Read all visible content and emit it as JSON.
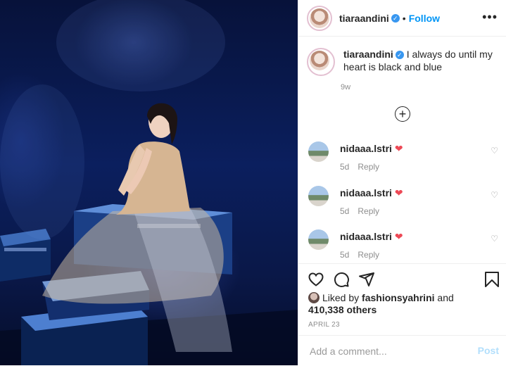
{
  "post": {
    "username": "tiaraandini",
    "separator": "•",
    "follow_label": "Follow",
    "more_icon": "more-horizontal-icon",
    "caption": "I always do until my heart is black and blue",
    "time": "9w",
    "load_more_icon": "plus-circle-icon"
  },
  "comments": [
    {
      "username": "nidaaa.lstri",
      "emoji": "❤",
      "time": "5d",
      "reply_label": "Reply"
    },
    {
      "username": "nidaaa.lstri",
      "emoji": "❤",
      "time": "5d",
      "reply_label": "Reply"
    },
    {
      "username": "nidaaa.lstri",
      "emoji": "❤",
      "time": "5d",
      "reply_label": "Reply"
    }
  ],
  "likes": {
    "prefix": "Liked by",
    "user": "fashionsyahrini",
    "and": "and",
    "count": "410,338 others"
  },
  "date": "APRIL 23",
  "add_comment": {
    "placeholder": "Add a comment...",
    "post_label": "Post"
  },
  "colors": {
    "accent": "#0095f6",
    "heart": "#ed4956",
    "post_disabled": "#b2dffc"
  }
}
